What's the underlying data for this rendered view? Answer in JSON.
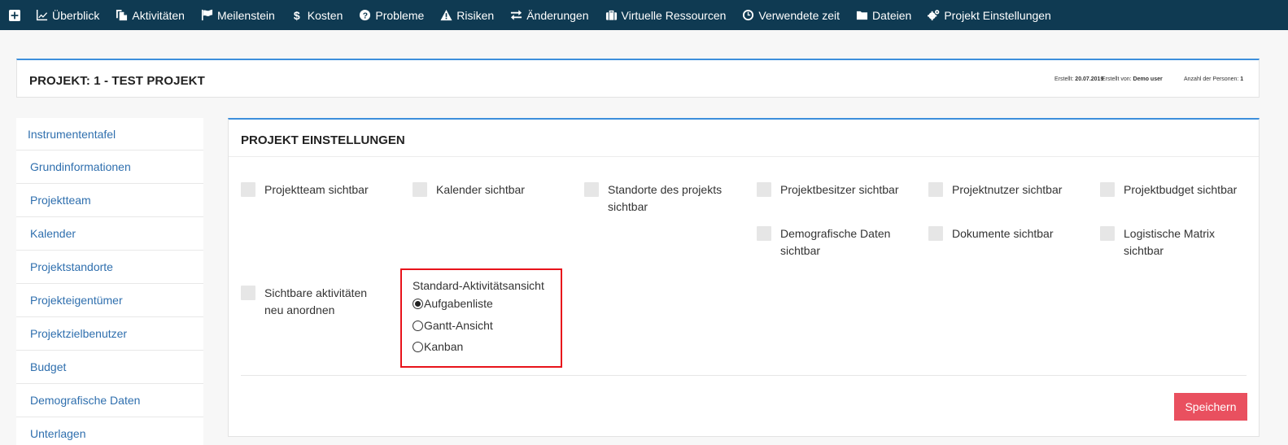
{
  "nav": {
    "items": [
      {
        "label": "Überblick",
        "icon": "line-chart-icon"
      },
      {
        "label": "Aktivitäten",
        "icon": "copy-icon"
      },
      {
        "label": "Meilenstein",
        "icon": "flag-icon"
      },
      {
        "label": "Kosten",
        "icon": "dollar-icon"
      },
      {
        "label": "Probleme",
        "icon": "question-circle-icon"
      },
      {
        "label": "Risiken",
        "icon": "warning-icon"
      },
      {
        "label": "Änderungen",
        "icon": "exchange-icon"
      },
      {
        "label": "Virtuelle Ressourcen",
        "icon": "briefcase-icon"
      },
      {
        "label": "Verwendete zeit",
        "icon": "clock-icon"
      },
      {
        "label": "Dateien",
        "icon": "folder-icon"
      },
      {
        "label": "Projekt Einstellungen",
        "icon": "cogs-icon"
      }
    ]
  },
  "project": {
    "title": "PROJEKT: 1 - TEST PROJEKT",
    "created_label": "Erstellt:",
    "created_value": "20.07.2019",
    "created_by_label": "Erstellt von:",
    "created_by_value": "Demo user",
    "persons_label": "Anzahl der Personen:",
    "persons_value": "1"
  },
  "sidebar": {
    "items": [
      "Instrumententafel",
      "Grundinformationen",
      "Projektteam",
      "Kalender",
      "Projektstandorte",
      "Projekteigentümer",
      "Projektzielbenutzer",
      "Budget",
      "Demografische Daten",
      "Unterlagen"
    ]
  },
  "settings": {
    "title": "PROJEKT EINSTELLUNGEN",
    "options": [
      {
        "line1": "Projektteam sichtbar",
        "line2": ""
      },
      {
        "line1": "Kalender sichtbar",
        "line2": ""
      },
      {
        "line1": "Standorte des projekts",
        "line2": "sichtbar"
      },
      {
        "line1": "Projektbesitzer sichtbar",
        "line2": ""
      },
      {
        "line1": "Projektnutzer sichtbar",
        "line2": ""
      },
      {
        "line1": "Projektbudget sichtbar",
        "line2": ""
      },
      {
        "line1": "Demografische Daten",
        "line2": "sichtbar"
      },
      {
        "line1": "Dokumente sichtbar",
        "line2": ""
      },
      {
        "line1": "Logistische Matrix",
        "line2": "sichtbar"
      },
      {
        "line1": "Sichtbare aktivitäten",
        "line2": "neu anordnen"
      }
    ],
    "default_view": {
      "title": "Standard-Aktivitätsansicht",
      "options": [
        "Aufgabenliste",
        "Gantt-Ansicht",
        "Kanban"
      ],
      "selected": "Aufgabenliste"
    },
    "save_label": "Speichern"
  },
  "colors": {
    "nav_bg": "#0f3a52",
    "accent": "#3d8fdc",
    "link": "#2f6fae",
    "save_button": "#e9505f",
    "highlight": "#e8131b"
  }
}
